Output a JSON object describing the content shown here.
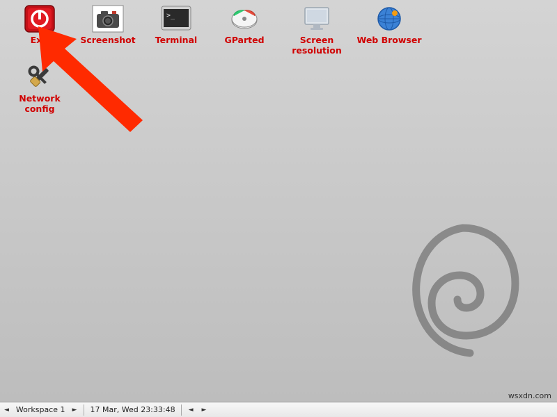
{
  "desktop_icons_row1": [
    {
      "id": "exit",
      "label": "Exit"
    },
    {
      "id": "screenshot",
      "label": "Screenshot"
    },
    {
      "id": "terminal",
      "label": "Terminal"
    },
    {
      "id": "gparted",
      "label": "GParted"
    },
    {
      "id": "screenres",
      "label": "Screen resolution"
    },
    {
      "id": "webbrowser",
      "label": "Web Browser"
    }
  ],
  "desktop_icons_row2": [
    {
      "id": "netconfig",
      "label": "Network config"
    }
  ],
  "taskbar": {
    "workspace_label": "Workspace 1",
    "datetime": "17 Mar, Wed 23:33:48",
    "nav_left": "◄",
    "nav_right": "►"
  },
  "watermark": "wsxdn.com",
  "colors": {
    "label": "#d00000",
    "arrow": "#ff2a00"
  }
}
